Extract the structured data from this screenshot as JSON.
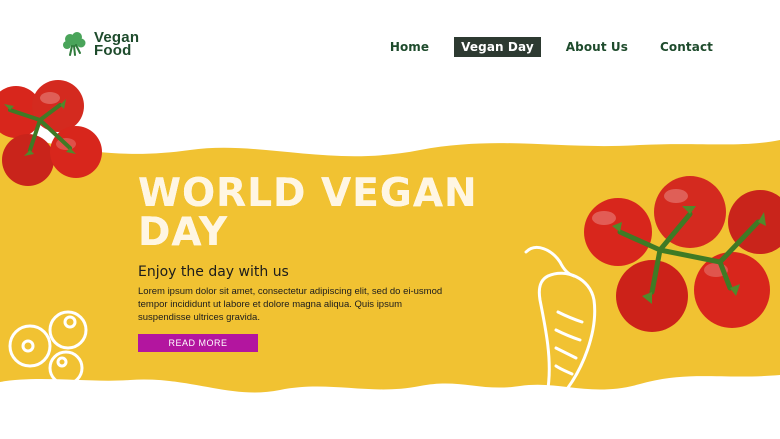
{
  "logo": {
    "line1": "Vegan",
    "line2": "Food",
    "icon": "broccoli-icon"
  },
  "nav": {
    "items": [
      {
        "label": "Home",
        "active": false
      },
      {
        "label": "Vegan Day",
        "active": true
      },
      {
        "label": "About Us",
        "active": false
      },
      {
        "label": "Contact",
        "active": false
      }
    ]
  },
  "hero": {
    "title_line1": "WORLD VEGAN",
    "title_line2": "DAY",
    "subtitle": "Enjoy the day with us",
    "body": "Lorem ipsum dolor sit amet, consectetur adipiscing elit, sed do ei-usmod tempor incididunt ut labore et dolore magna aliqua. Quis ipsum suspendisse ultrices gravida.",
    "cta_label": "READ MORE"
  },
  "colors": {
    "banner_yellow": "#f1c232",
    "brand_green": "#1e4b2c",
    "cta_magenta": "#b3159f",
    "tomato_red": "#d8261c"
  }
}
